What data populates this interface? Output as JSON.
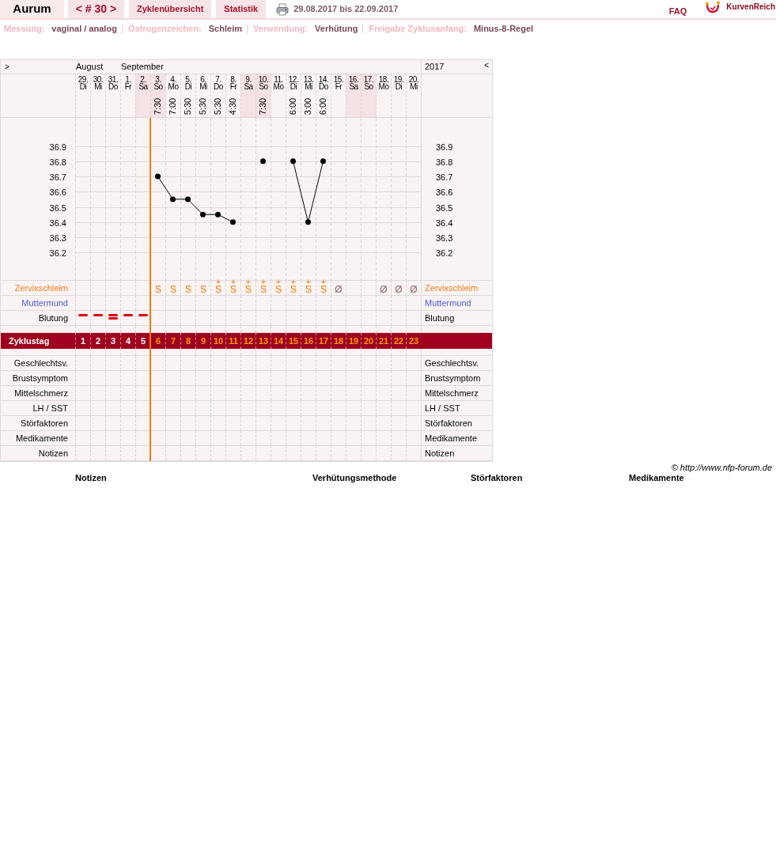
{
  "nav": {
    "title": "Aurum",
    "cycle": "< # 30 >",
    "tabs": [
      {
        "label": "Zyklenübersicht"
      },
      {
        "label": "Statistik"
      }
    ],
    "date_range": "29.08.2017 bis 22.09.2017",
    "faq": "FAQ",
    "logo": "KurvenReich"
  },
  "settings": [
    {
      "label": "Messung:",
      "value": "vaginal / analog"
    },
    {
      "label": "Östrogenzeichen:",
      "value": "Schleim"
    },
    {
      "label": "Verwendung:",
      "value": "Verhütung"
    },
    {
      "label": "Freigabe Zyklusanfang:",
      "value": "Minus-8-Regel"
    }
  ],
  "chart": {
    "nav_left": ">",
    "nav_right": "<",
    "year": "2017",
    "days": [
      {
        "month": "August",
        "date": "29.",
        "weekday": "Di",
        "weekend": false,
        "cycle_day": "1",
        "infertile": true,
        "bleeding": {
          "kind": "medium"
        }
      },
      {
        "date": "30.",
        "weekday": "Mi",
        "weekend": false,
        "cycle_day": "2",
        "infertile": true,
        "bleeding": {
          "kind": "medium"
        }
      },
      {
        "date": "31.",
        "weekday": "Do",
        "weekend": false,
        "cycle_day": "3",
        "infertile": true,
        "bleeding": {
          "kind": "heavy"
        }
      },
      {
        "month": "September",
        "date": "1.",
        "weekday": "Fr",
        "weekend": false,
        "cycle_day": "4",
        "infertile": true,
        "bleeding": {
          "kind": "medium"
        }
      },
      {
        "date": "2.",
        "weekday": "Sa",
        "weekend": true,
        "cycle_day": "5",
        "infertile": true,
        "bleeding": {
          "kind": "medium"
        }
      },
      {
        "date": "3.",
        "weekday": "So",
        "weekend": true,
        "time": "7:30",
        "cycle_day": "6",
        "infertile": false,
        "mucus": {
          "kind": "mucus",
          "sign": "S"
        }
      },
      {
        "date": "4.",
        "weekday": "Mo",
        "weekend": false,
        "time": "7:00",
        "cycle_day": "7",
        "infertile": false,
        "mucus": {
          "kind": "mucus",
          "sign": "S"
        }
      },
      {
        "date": "5.",
        "weekday": "Di",
        "weekend": false,
        "time": "5:30",
        "cycle_day": "8",
        "infertile": false,
        "mucus": {
          "kind": "mucus",
          "sign": "S"
        }
      },
      {
        "date": "6.",
        "weekday": "Mi",
        "weekend": false,
        "time": "5:30",
        "cycle_day": "9",
        "infertile": false,
        "mucus": {
          "kind": "mucus",
          "sign": "S"
        }
      },
      {
        "date": "7.",
        "weekday": "Do",
        "weekend": false,
        "time": "5:30",
        "cycle_day": "10",
        "infertile": false,
        "mucus": {
          "kind": "mucus",
          "sign": "S",
          "plus": "+"
        }
      },
      {
        "date": "8.",
        "weekday": "Fr",
        "weekend": false,
        "time": "4:30",
        "cycle_day": "11",
        "infertile": false,
        "mucus": {
          "kind": "mucus",
          "sign": "S",
          "plus": "+"
        }
      },
      {
        "date": "9.",
        "weekday": "Sa",
        "weekend": true,
        "cycle_day": "12",
        "infertile": false,
        "mucus": {
          "kind": "mucus",
          "sign": "S",
          "plus": "+"
        }
      },
      {
        "date": "10.",
        "weekday": "So",
        "weekend": true,
        "time": "7:30",
        "cycle_day": "13",
        "infertile": false,
        "mucus": {
          "kind": "mucus",
          "sign": "S",
          "plus": "+"
        }
      },
      {
        "date": "11.",
        "weekday": "Mo",
        "weekend": false,
        "cycle_day": "14",
        "infertile": false,
        "mucus": {
          "kind": "mucus",
          "sign": "S",
          "plus": "+"
        }
      },
      {
        "date": "12.",
        "weekday": "Di",
        "weekend": false,
        "time": "6:00",
        "cycle_day": "15",
        "infertile": false,
        "mucus": {
          "kind": "mucus",
          "sign": "S",
          "plus": "+"
        }
      },
      {
        "date": "13.",
        "weekday": "Mi",
        "weekend": false,
        "time": "3:00",
        "cycle_day": "16",
        "infertile": false,
        "mucus": {
          "kind": "mucus",
          "sign": "S",
          "plus": "+"
        }
      },
      {
        "date": "14.",
        "weekday": "Do",
        "weekend": false,
        "time": "6:00",
        "cycle_day": "17",
        "infertile": false,
        "mucus": {
          "kind": "mucus",
          "sign": "S",
          "plus": "+"
        }
      },
      {
        "date": "15.",
        "weekday": "Fr",
        "weekend": false,
        "cycle_day": "18",
        "infertile": false,
        "mucus": {
          "kind": "dry",
          "sign": "Ø"
        }
      },
      {
        "date": "16.",
        "weekday": "Sa",
        "weekend": true,
        "cycle_day": "19",
        "infertile": false
      },
      {
        "date": "17.",
        "weekday": "So",
        "weekend": true,
        "cycle_day": "20",
        "infertile": false
      },
      {
        "date": "18.",
        "weekday": "Mo",
        "weekend": false,
        "cycle_day": "21",
        "infertile": false,
        "mucus": {
          "kind": "dry",
          "sign": "Ø"
        }
      },
      {
        "date": "19.",
        "weekday": "Di",
        "weekend": false,
        "cycle_day": "22",
        "infertile": false,
        "mucus": {
          "kind": "dry",
          "sign": "Ø"
        }
      },
      {
        "date": "20.",
        "weekday": "Mi",
        "weekend": false,
        "cycle_day": "23",
        "infertile": false,
        "mucus": {
          "kind": "dry",
          "sign": "Ø"
        }
      }
    ],
    "temperature": {
      "chart_data": {
        "type": "line",
        "grid": true,
        "ylim": [
          36.02,
          37.37
        ],
        "yticks": [
          36.2,
          36.3,
          36.4,
          36.5,
          36.6,
          36.7,
          36.8,
          36.9
        ],
        "series": [
          {
            "color": "#000000",
            "marker": true,
            "values": [
              null,
              null,
              null,
              null,
              null,
              36.7,
              36.55,
              36.55,
              36.45,
              36.45,
              36.4,
              null,
              36.8,
              null,
              36.8,
              36.4,
              36.8,
              null,
              null,
              null,
              null,
              null,
              null
            ]
          }
        ]
      },
      "right_labels": [
        "36.9",
        "36.8",
        "36.7",
        "36.6",
        "36.5",
        "36.4",
        "36.3",
        "36.2"
      ]
    },
    "rows": [
      {
        "kind": "mucus",
        "label": "Zervixschleim",
        "label_right": "Zervixschleim"
      },
      {
        "kind": "cervix",
        "label": "Muttermund",
        "label_right": "Muttermund"
      },
      {
        "kind": "bleeding",
        "label": "Blutung",
        "label_right": "Blutung"
      },
      {
        "kind": "spacer"
      },
      {
        "kind": "cycle_day",
        "label": "Zyklustag"
      },
      {
        "kind": "spacer"
      },
      {
        "kind": "plain",
        "label": "Geschlechtsv.",
        "label_right": "Geschlechtsv."
      },
      {
        "kind": "plain",
        "label": "Brustsymptom",
        "label_right": "Brustsymptom"
      },
      {
        "kind": "plain",
        "label": "Mittelschmerz",
        "label_right": "Mittelschmerz"
      },
      {
        "kind": "plain",
        "label": "LH / SST",
        "label_right": "LH / SST"
      },
      {
        "kind": "plain",
        "label": "Störfaktoren",
        "label_right": "Störfaktoren"
      },
      {
        "kind": "plain",
        "label": "Medikamente",
        "label_right": "Medikamente"
      },
      {
        "kind": "plain",
        "label": "Notizen",
        "label_right": "Notizen"
      }
    ]
  },
  "footer": {
    "copyright": "© http://www.nfp-forum.de",
    "columns": [
      {
        "label": "Notizen"
      },
      {
        "label": "Verhütungsmethode"
      },
      {
        "label": "Störfaktoren"
      },
      {
        "label": "Medikamente"
      }
    ]
  }
}
